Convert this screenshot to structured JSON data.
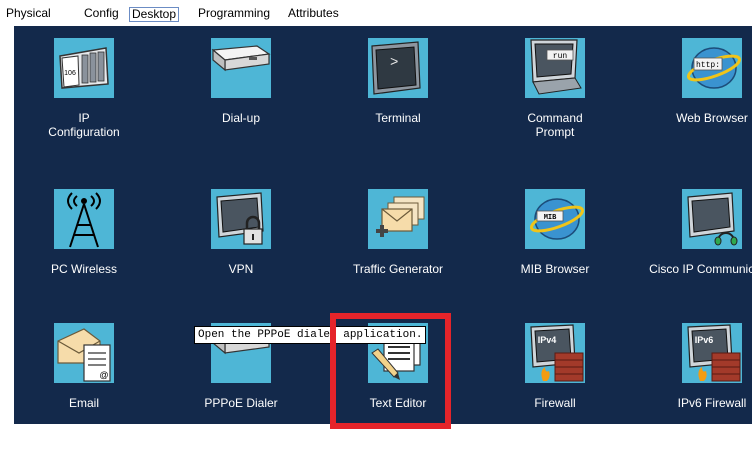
{
  "tabs": [
    {
      "label": "Physical"
    },
    {
      "label": "Config"
    },
    {
      "label": "Desktop"
    },
    {
      "label": "Programming"
    },
    {
      "label": "Attributes"
    }
  ],
  "active_tab": "Desktop",
  "apps": [
    {
      "label": "IP\nConfiguration",
      "icon": "ip-configuration-icon",
      "screen_text": "106"
    },
    {
      "label": "Dial-up",
      "icon": "dial-up-icon"
    },
    {
      "label": "Terminal",
      "icon": "terminal-icon",
      "screen_text": ">"
    },
    {
      "label": "Command\nPrompt",
      "icon": "command-prompt-icon",
      "screen_text": "run"
    },
    {
      "label": "Web Browser",
      "icon": "web-browser-icon",
      "screen_text": "http:"
    },
    {
      "label": "PC Wireless",
      "icon": "pc-wireless-icon"
    },
    {
      "label": "VPN",
      "icon": "vpn-lock-icon"
    },
    {
      "label": "Traffic Generator",
      "icon": "traffic-generator-icon"
    },
    {
      "label": "MIB Browser",
      "icon": "mib-browser-icon",
      "screen_text": "MIB"
    },
    {
      "label": "Cisco IP Communicator",
      "icon": "ip-communicator-icon"
    },
    {
      "label": "Email",
      "icon": "email-icon",
      "screen_text": "@"
    },
    {
      "label": "PPPoE Dialer",
      "icon": "pppoe-dialer-icon"
    },
    {
      "label": "Text Editor",
      "icon": "text-editor-icon"
    },
    {
      "label": "Firewall",
      "icon": "firewall-icon",
      "screen_text": "IPv4"
    },
    {
      "label": "IPv6 Firewall",
      "icon": "ipv6-firewall-icon",
      "screen_text": "IPv6"
    }
  ],
  "tooltip": "Open the PPPoE dialer application.",
  "colors": {
    "desktop_bg": "#13294b",
    "tile_bg": "#4eb6d6",
    "highlight": "#e5242a"
  }
}
